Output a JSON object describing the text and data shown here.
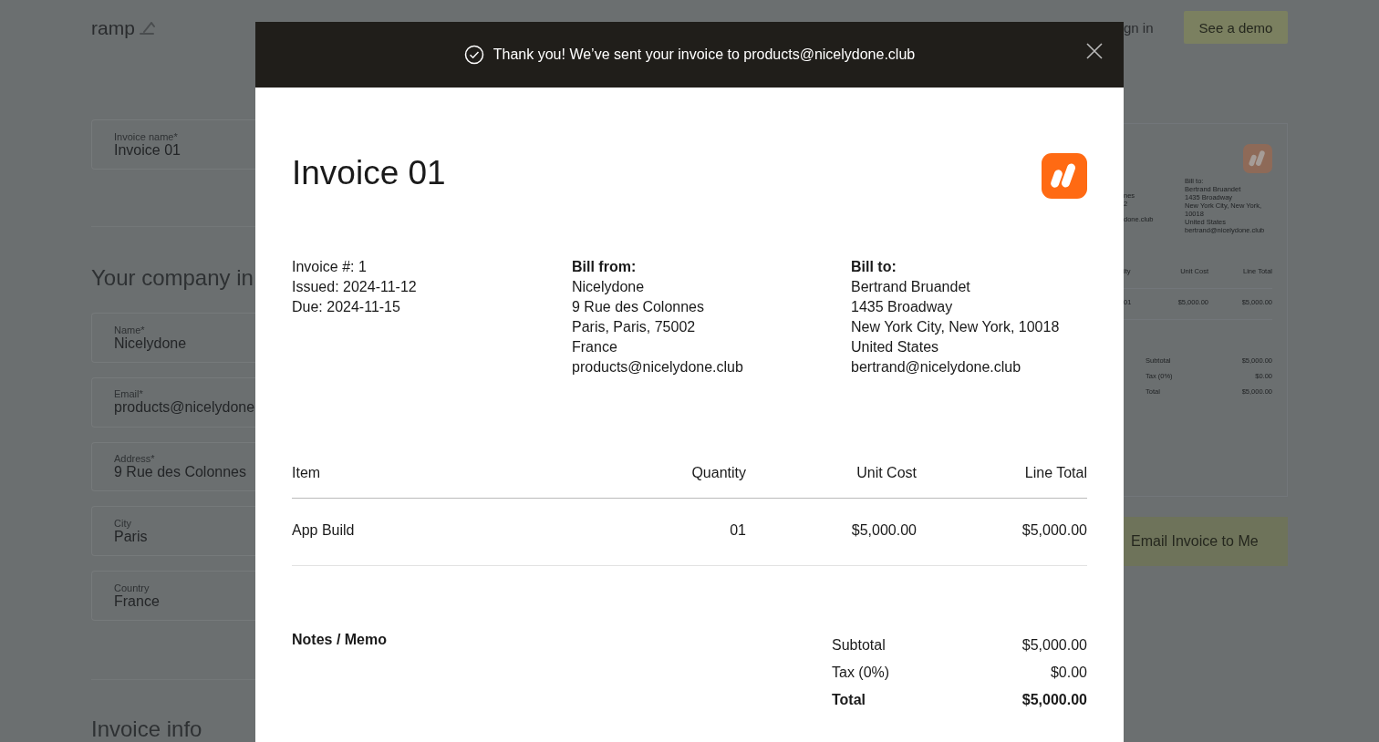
{
  "header": {
    "logo": "ramp",
    "nav_link": "gn in",
    "demo_button": "See a demo"
  },
  "form": {
    "top_fields": [
      {
        "label": "Invoice name*",
        "value": "Invoice 01"
      }
    ],
    "company_heading": "Your company in",
    "company_fields": [
      {
        "label": "Name*",
        "value": "Nicelydone"
      },
      {
        "label": "Email*",
        "value": "products@nicelydone"
      },
      {
        "label": "Address*",
        "value": "9 Rue des Colonnes"
      },
      {
        "label": "City",
        "value": "Paris"
      },
      {
        "label": "Country",
        "value": "France"
      }
    ],
    "invoice_heading": "Invoice info"
  },
  "preview": {
    "column_1": [
      "nes",
      "2",
      "done.club"
    ],
    "bill_to": [
      "Bill to:",
      "Bertrand Bruandet",
      "1435 Broadway",
      "New York City, New York, 10018",
      "United States",
      "bertrand@nicelydone.club"
    ],
    "columns": [
      "ity",
      "Unit Cost",
      "Line Total"
    ],
    "row": [
      "01",
      "$5,000.00",
      "$5,000.00"
    ],
    "totals": [
      {
        "label": "Subtotal",
        "value": "$5,000.00"
      },
      {
        "label": "Tax (0%)",
        "value": "$0.00"
      },
      {
        "label": "Total",
        "value": "$5,000.00"
      }
    ],
    "email_button": "Email Invoice to Me"
  },
  "modal": {
    "banner": "Thank you! We’ve sent your invoice to products@nicelydone.club",
    "invoice": {
      "title": "Invoice 01",
      "meta": [
        "Invoice #: 1",
        "Issued: 2024-11-12",
        "Due: 2024-11-15"
      ],
      "bill_from": {
        "heading": "Bill from:",
        "lines": [
          "Nicelydone",
          "9 Rue des Colonnes",
          "Paris, Paris, 75002",
          "France",
          "products@nicelydone.club"
        ]
      },
      "bill_to": {
        "heading": "Bill to:",
        "lines": [
          "Bertrand Bruandet",
          "1435 Broadway",
          "New York City, New York, 10018",
          "United States",
          "bertrand@nicelydone.club"
        ]
      },
      "columns": [
        "Item",
        "Quantity",
        "Unit Cost",
        "Line Total"
      ],
      "rows": [
        [
          "App Build",
          "01",
          "$5,000.00",
          "$5,000.00"
        ]
      ],
      "notes_label": "Notes / Memo",
      "totals": [
        {
          "label": "Subtotal",
          "value": "$5,000.00",
          "kind": "normal"
        },
        {
          "label": "Tax (0%)",
          "value": "$0.00",
          "kind": "normal"
        },
        {
          "label": "Total",
          "value": "$5,000.00",
          "kind": "grand"
        }
      ]
    }
  }
}
